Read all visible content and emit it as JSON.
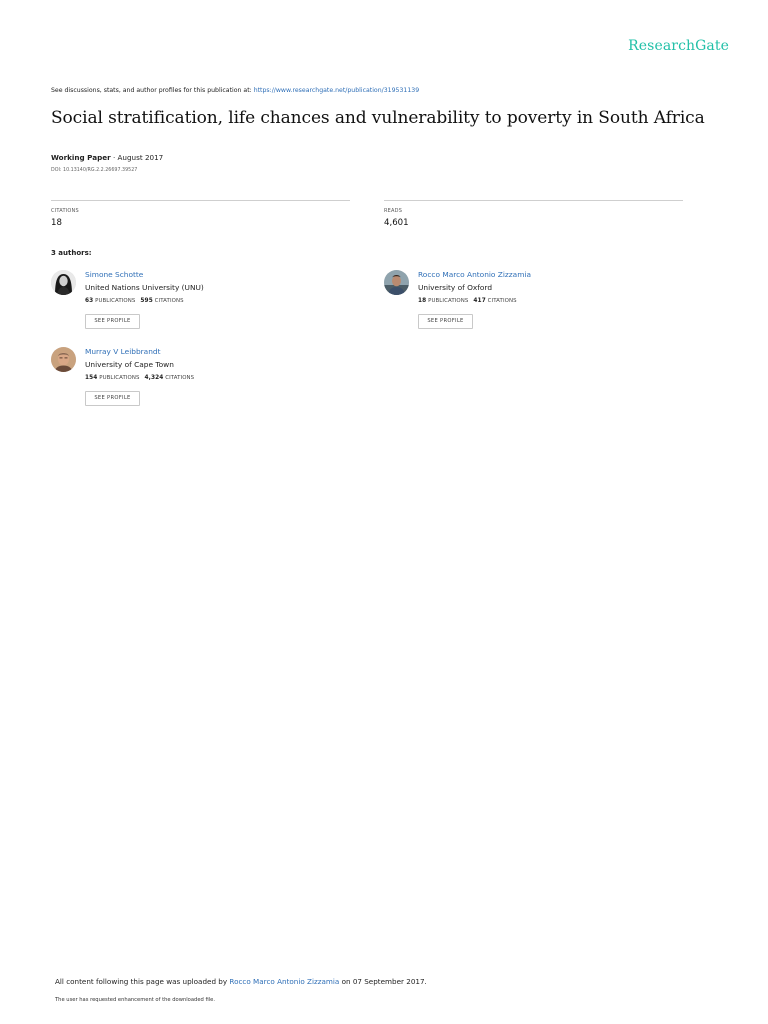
{
  "header": {
    "logo": "ResearchGate",
    "discussions_text": "See discussions, stats, and author profiles for this publication at: ",
    "publication_link": "https://www.researchgate.net/publication/319531139"
  },
  "publication": {
    "title": "Social stratification, life chances and vulnerability to poverty in South Africa",
    "type": "Working Paper",
    "date": " · August 2017",
    "doi": "DOI: 10.13140/RG.2.2.26697.39527"
  },
  "stats": {
    "citations_label": "CITATIONS",
    "citations_value": "18",
    "reads_label": "READS",
    "reads_value": "4,601"
  },
  "authors_heading": "3 authors:",
  "authors": [
    {
      "name": "Simone Schotte",
      "institution": "United Nations University (UNU)",
      "publications": "63",
      "publications_label": "PUBLICATIONS",
      "citations": "595",
      "citations_label": "CITATIONS",
      "button": "SEE PROFILE"
    },
    {
      "name": "Rocco Marco Antonio Zizzamia",
      "institution": "University of Oxford",
      "publications": "18",
      "publications_label": "PUBLICATIONS",
      "citations": "417",
      "citations_label": "CITATIONS",
      "button": "SEE PROFILE"
    },
    {
      "name": "Murray V Leibbrandt",
      "institution": "University of Cape Town",
      "publications": "154",
      "publications_label": "PUBLICATIONS",
      "citations": "4,324",
      "citations_label": "CITATIONS",
      "button": "SEE PROFILE"
    }
  ],
  "footer": {
    "upload_prefix": "All content following this page was uploaded by ",
    "uploader": "Rocco Marco Antonio Zizzamia",
    "upload_suffix": " on 07 September 2017.",
    "note": "The user has requested enhancement of the downloaded file."
  },
  "colors": {
    "brand": "#22c0a8",
    "link": "#2f6fb7"
  }
}
